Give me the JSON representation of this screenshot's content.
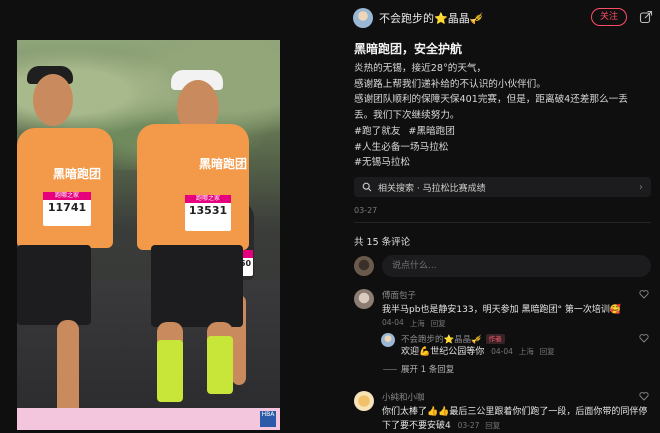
{
  "author": {
    "name": "不会跑步的⭐晶晶🎺",
    "follow_label": "关注"
  },
  "post": {
    "title": "黑暗跑团，安全护航",
    "body_lines": [
      "炎热的无锡，接近28°的天气，",
      "感谢路上帮我们递补给的不认识的小伙伴们。",
      "感谢团队顺利的保障天保401完赛，但是，距离破4还差那么一丢",
      "丢。我们下次继续努力。"
    ],
    "tags": [
      "#跑了就友",
      "#黑暗跑团",
      "#人生必备一场马拉松",
      "#无锡马拉松"
    ],
    "related_search": "相关搜索 · 马拉松比赛成绩",
    "date": "03-27"
  },
  "photo": {
    "bib_left": "11741",
    "bib_right": "13531",
    "bib_mid": "4250",
    "bib_brand": "跑哪之家",
    "club_text": "黑暗跑团",
    "banner_logo": "HBA"
  },
  "comments_section": {
    "count_label": "共 15 条评论",
    "input_placeholder": "说点什么...",
    "comments": [
      {
        "user": "傅面包子",
        "text": "我半马pb也是静安133，明天参加 黑暗跑团° 第一次培训🥰",
        "meta_date": "04-04",
        "meta_location": "上海",
        "meta_reply": "回复"
      },
      {
        "user": "不会跑步的⭐晶晶🎺",
        "badge": "作者",
        "text": "欢迎💪世纪公园等你",
        "meta_date": "04-04",
        "meta_location": "上海",
        "meta_reply": "回复"
      },
      {
        "user": "小純和小咖",
        "text": "你们太棒了👍👍最后三公里跟着你们跑了一段，后面你带的同伴停下了要不要安破4",
        "meta_date": "03-27",
        "meta_location": "",
        "meta_reply": "回复"
      }
    ],
    "expand_label": "展开 1 条回复"
  },
  "colors": {
    "background": "#0f0f10",
    "accent": "#ff4d64",
    "shirt": "#f39a4a",
    "sock": "#c8e63a"
  }
}
